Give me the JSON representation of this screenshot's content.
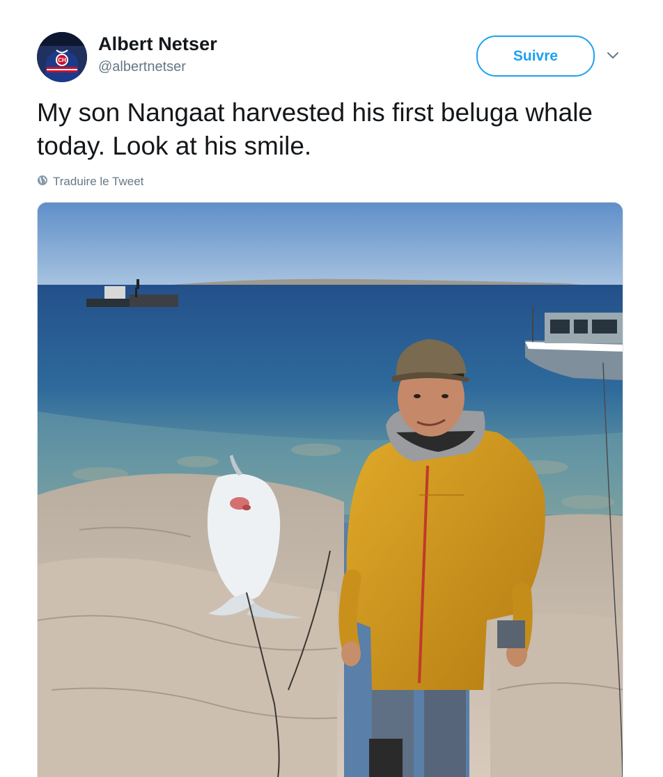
{
  "author": {
    "display_name": "Albert Netser",
    "handle": "@albertnetser",
    "avatar_icon": "avatar-hockey-jersey"
  },
  "actions": {
    "follow_label": "Suivre",
    "more_icon": "chevron-down-icon"
  },
  "tweet": {
    "text": "My son Nangaat harvested his first beluga whale today. Look at his smile.",
    "translate_label": "Traduire le Tweet",
    "translate_icon": "globe-icon"
  },
  "media": {
    "description_icon": "photo"
  },
  "colors": {
    "accent": "#1da1f2",
    "secondary_text": "#657786",
    "primary_text": "#14171a"
  }
}
